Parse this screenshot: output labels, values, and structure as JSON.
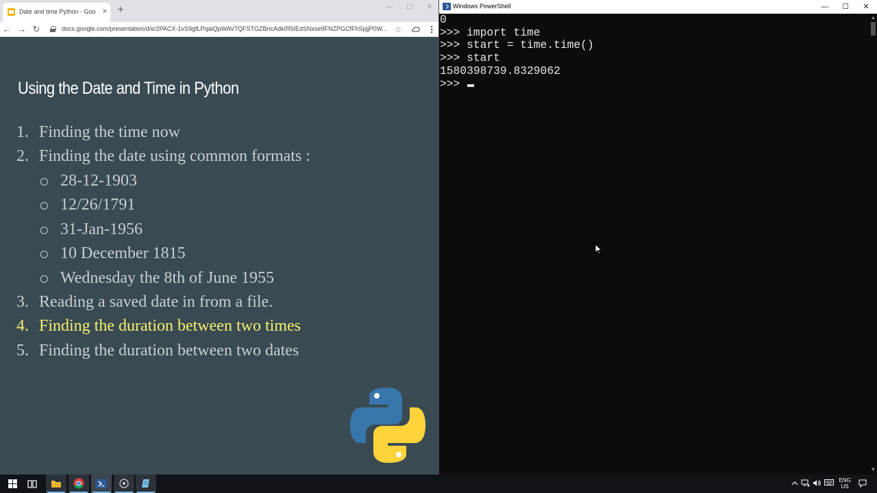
{
  "browser": {
    "tab_title": "Date and time Python - Google",
    "tab_close": "×",
    "new_tab": "+",
    "url": "docs.google.com/presentation/d/e/2PACX-1vS9gfLPqaiQpWAV7QFSTGZBncAdkIR5IEdSNxse9FNZPGCfFhSpjjP0W...",
    "back": "←",
    "forward": "→",
    "reload": "↻",
    "star": "☆",
    "minimize": "—",
    "maximize": "☐",
    "close": "✕"
  },
  "slide": {
    "title": "Using the Date and Time in Python",
    "items": [
      {
        "num": "1.",
        "text": "Finding the time now"
      },
      {
        "num": "2.",
        "text": "Finding the date using common formats :"
      },
      {
        "num": "3.",
        "text": "Reading a saved date in from a file."
      },
      {
        "num": "4.",
        "text": "Finding the duration between two times"
      },
      {
        "num": "5.",
        "text": "Finding the duration between two dates"
      }
    ],
    "subitems": [
      "28-12-1903",
      "12/26/1791",
      "31-Jan-1956",
      "10 December 1815",
      "Wednesday the 8th of June 1955"
    ],
    "highlight_color": "#f5f06e",
    "text_color": "#c9cfd2",
    "background": "#3a4a52"
  },
  "powershell": {
    "title": "Windows PowerShell",
    "minimize": "—",
    "maximize": "☐",
    "close": "✕",
    "lines": [
      "0",
      ">>> import time",
      ">>> start = time.time()",
      ">>> start",
      "1580398739.8329062",
      ">>> "
    ]
  },
  "taskbar": {
    "lang_top": "ENG",
    "lang_bottom": "US"
  }
}
